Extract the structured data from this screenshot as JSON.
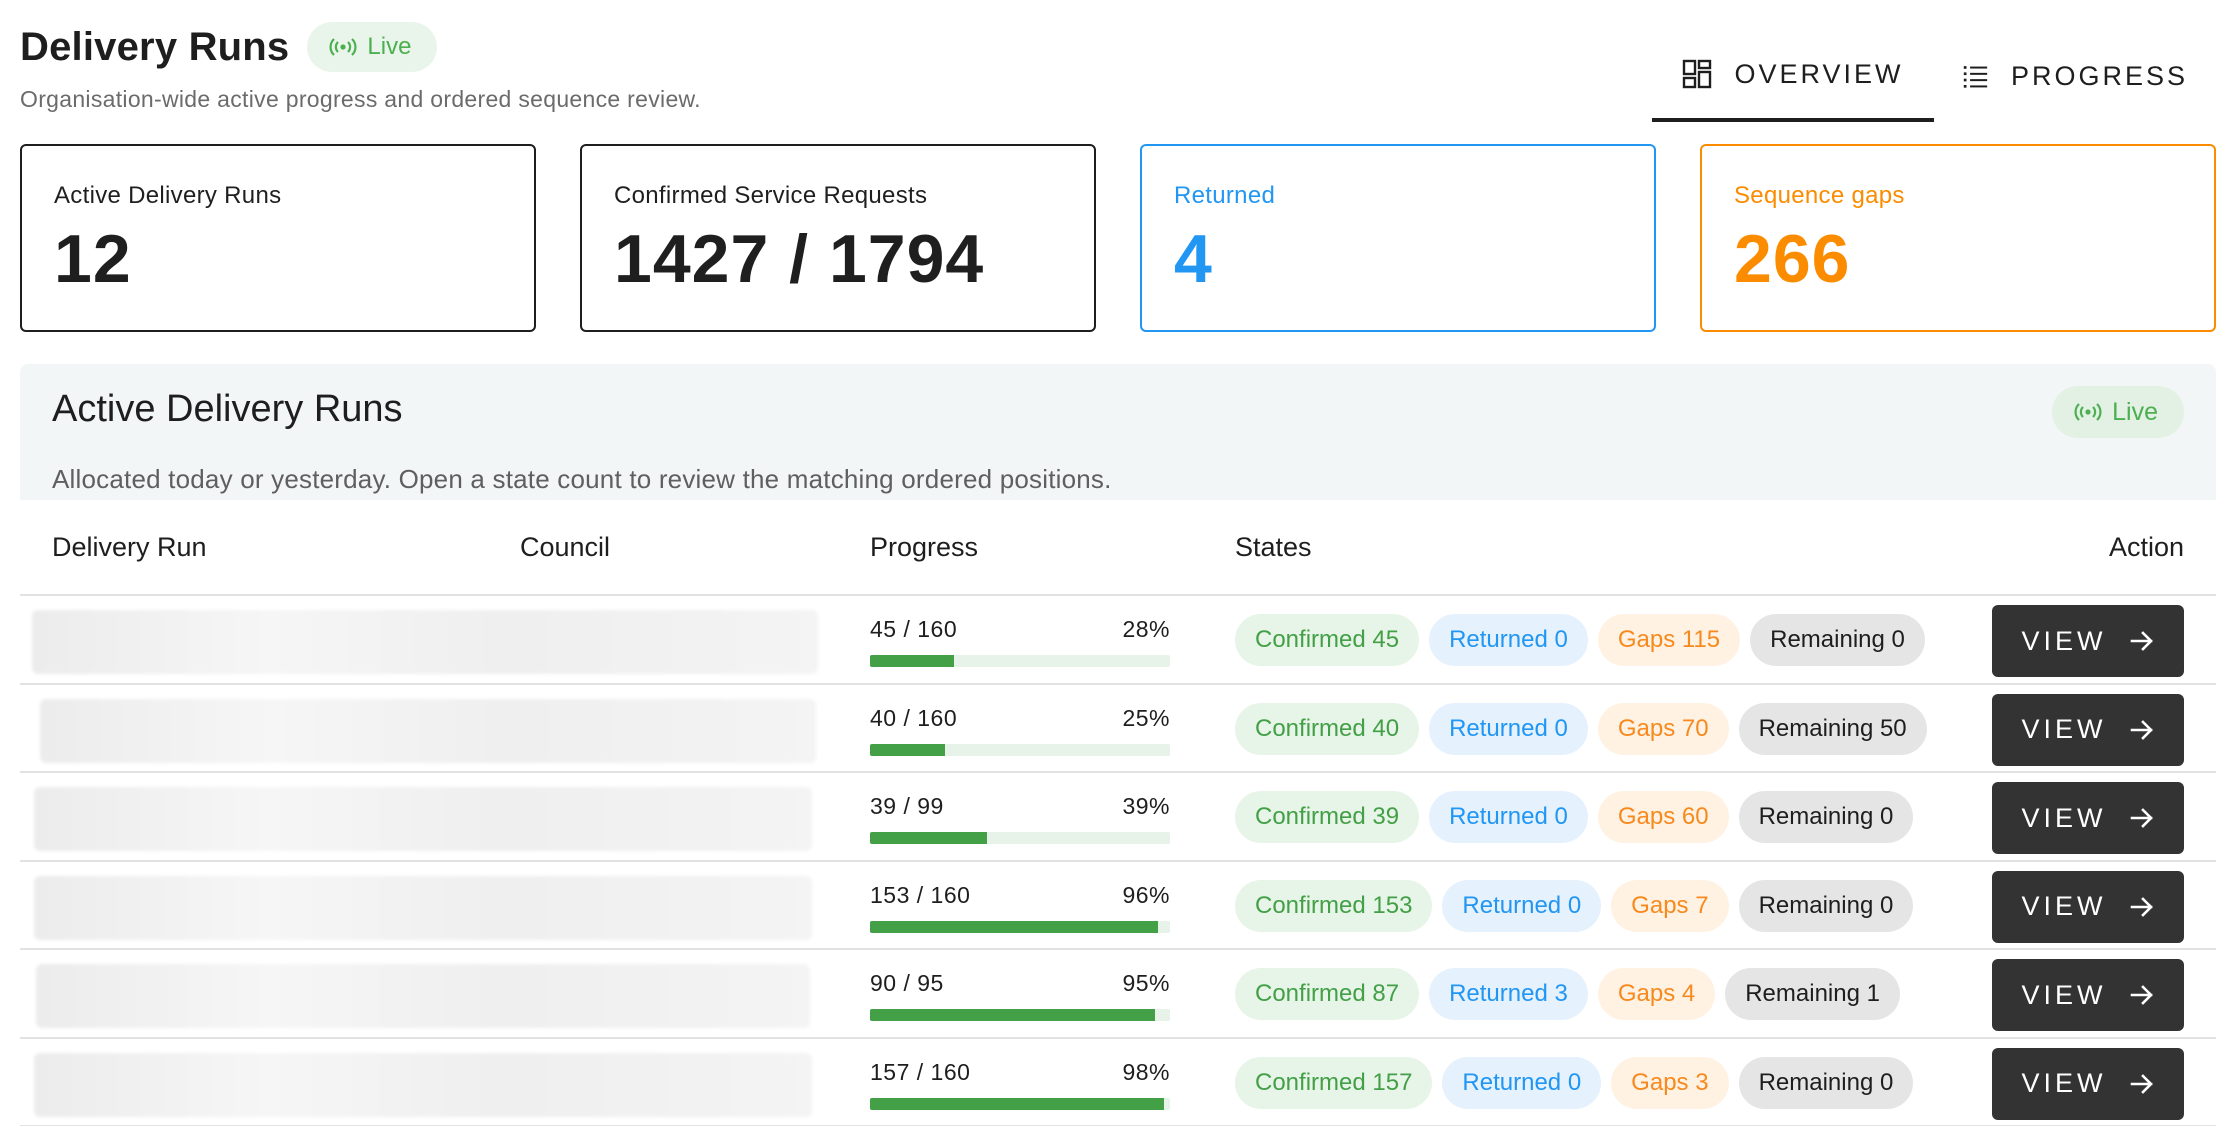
{
  "header": {
    "title": "Delivery Runs",
    "live_label": "Live",
    "subtitle": "Organisation-wide active progress and ordered sequence review."
  },
  "tabs": [
    {
      "label": "OVERVIEW",
      "icon": "dashboard-icon",
      "active": true
    },
    {
      "label": "PROGRESS",
      "icon": "list-icon",
      "active": false
    }
  ],
  "stats": [
    {
      "label": "Active Delivery Runs",
      "value": "12"
    },
    {
      "label": "Confirmed Service Requests",
      "value": "1427 / 1794"
    },
    {
      "label": "Returned",
      "value": "4",
      "color": "#2196f3"
    },
    {
      "label": "Sequence gaps",
      "value": "266",
      "color": "#fb8c00"
    }
  ],
  "panel": {
    "title": "Active Delivery Runs",
    "live_label": "Live",
    "description": "Allocated today or yesterday. Open a state count to review the matching ordered positions."
  },
  "table": {
    "headers": {
      "run": "Delivery Run",
      "council": "Council",
      "progress": "Progress",
      "states": "States",
      "action": "Action"
    },
    "action_label": "VIEW",
    "rows": [
      {
        "progress_text": "45 / 160",
        "percent_text": "28%",
        "percent": 0.28,
        "confirmed": "Confirmed 45",
        "returned": "Returned 0",
        "gaps": "Gaps 115",
        "remaining": "Remaining 0"
      },
      {
        "progress_text": "40 / 160",
        "percent_text": "25%",
        "percent": 0.25,
        "confirmed": "Confirmed 40",
        "returned": "Returned 0",
        "gaps": "Gaps 70",
        "remaining": "Remaining 50"
      },
      {
        "progress_text": "39 / 99",
        "percent_text": "39%",
        "percent": 0.39,
        "confirmed": "Confirmed 39",
        "returned": "Returned 0",
        "gaps": "Gaps 60",
        "remaining": "Remaining 0"
      },
      {
        "progress_text": "153 / 160",
        "percent_text": "96%",
        "percent": 0.96,
        "confirmed": "Confirmed 153",
        "returned": "Returned 0",
        "gaps": "Gaps 7",
        "remaining": "Remaining 0"
      },
      {
        "progress_text": "90 / 95",
        "percent_text": "95%",
        "percent": 0.95,
        "confirmed": "Confirmed 87",
        "returned": "Returned 3",
        "gaps": "Gaps 4",
        "remaining": "Remaining 1"
      },
      {
        "progress_text": "157 / 160",
        "percent_text": "98%",
        "percent": 0.98,
        "confirmed": "Confirmed 157",
        "returned": "Returned 0",
        "gaps": "Gaps 3",
        "remaining": "Remaining 0"
      }
    ]
  },
  "colors": {
    "live_green": "#4caf50",
    "progress_fill": "#43a047",
    "returned_blue": "#2196f3",
    "gaps_orange": "#fb8c00",
    "button_dark": "#333333"
  }
}
